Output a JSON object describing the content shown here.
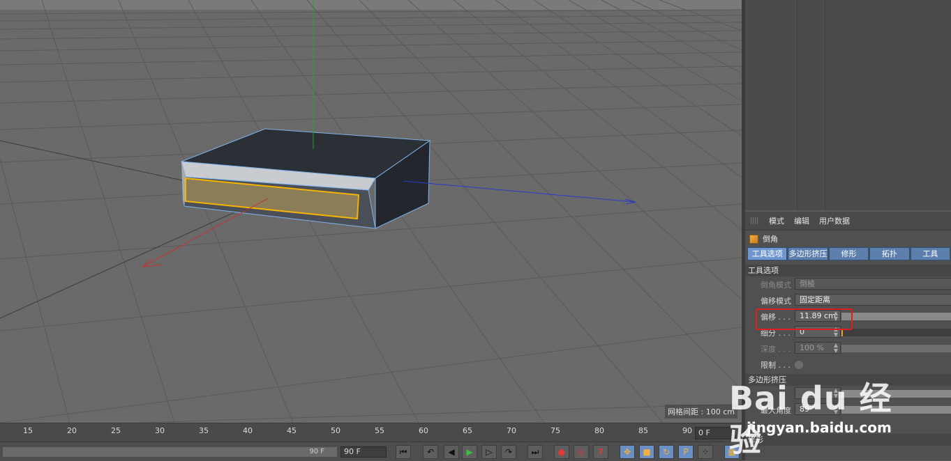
{
  "viewport": {
    "grid_info": "网格间距 : 100 cm"
  },
  "attributes": {
    "menu": [
      "模式",
      "编辑",
      "用户数据"
    ],
    "tool_name": "倒角",
    "tabs": [
      "工具选项",
      "多边形挤压",
      "修形",
      "拓扑",
      "工具"
    ],
    "section_tool_options": "工具选项",
    "bevel_mode_label": "倒角模式",
    "bevel_mode_value": "倒棱",
    "offset_mode_label": "偏移模式",
    "offset_mode_value": "固定距离",
    "offset_label": "偏移 . . .",
    "offset_value": "11.89 cm",
    "subdivision_label": "细分 . . .",
    "subdivision_value": "0",
    "depth_label": "深度 . . .",
    "depth_value": "100 %",
    "limit_label": "限制 . . .",
    "section_extrude": "多边形挤压",
    "max_angle_label": "最大角度",
    "max_angle_value": "89 °",
    "section_shaping": "修形"
  },
  "timeline": {
    "ticks": [
      "15",
      "20",
      "25",
      "30",
      "35",
      "40",
      "45",
      "50",
      "55",
      "60",
      "65",
      "70",
      "75",
      "80",
      "85",
      "90"
    ],
    "current_frame": "0 F",
    "end_label": "90 F",
    "end_field": "90 F"
  },
  "transport": {
    "buttons": [
      "go-start",
      "prev-key",
      "prev-frame",
      "play",
      "next-frame",
      "next-key",
      "go-end",
      "record",
      "autokey",
      "help",
      "move",
      "scale",
      "rotate",
      "param",
      "dots",
      "film"
    ]
  },
  "watermark": {
    "logo_text": "Bai du 经验",
    "url": "jingyan.baidu.com"
  },
  "colors": {
    "selection": "#f5b400",
    "x_axis": "#c83232",
    "y_axis": "#2aa02a",
    "z_axis": "#2a3acb",
    "highlight_box": "#e21d1d",
    "tab_blue": "#5c7fae"
  }
}
